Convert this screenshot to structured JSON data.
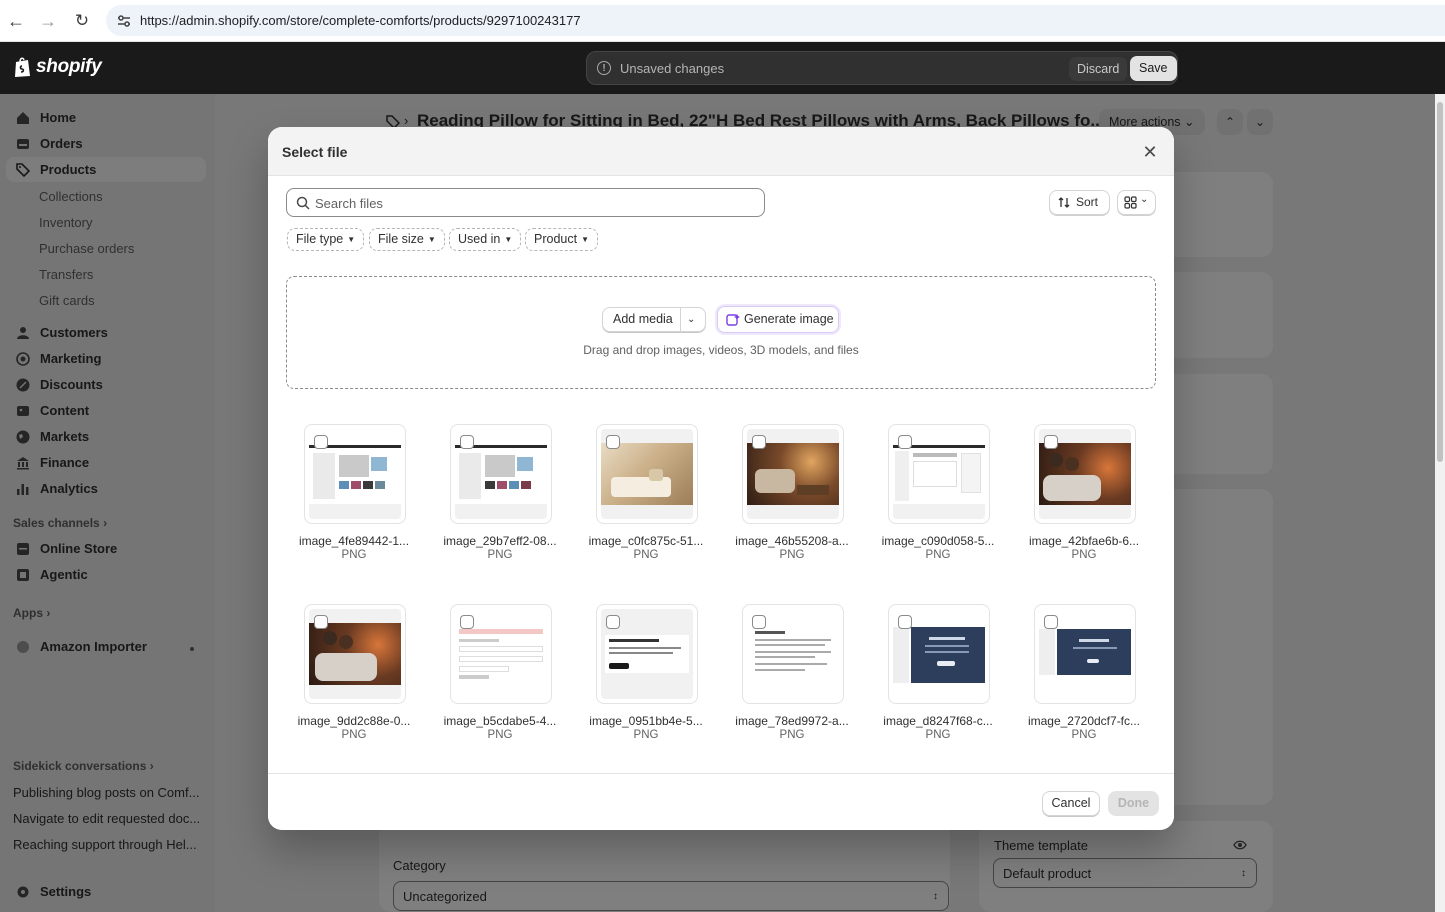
{
  "browser": {
    "url": "https://admin.shopify.com/store/complete-comforts/products/9297100243177"
  },
  "topbar": {
    "logo_text": "shopify",
    "unsaved_message": "Unsaved changes",
    "discard_label": "Discard",
    "save_label": "Save"
  },
  "sidebar": {
    "main_items": [
      {
        "label": "Home",
        "icon": "home-icon"
      },
      {
        "label": "Orders",
        "icon": "orders-icon"
      },
      {
        "label": "Products",
        "icon": "tag-icon",
        "active": true
      }
    ],
    "product_subitems": [
      "Collections",
      "Inventory",
      "Purchase orders",
      "Transfers",
      "Gift cards"
    ],
    "more_items": [
      {
        "label": "Customers",
        "icon": "person-icon"
      },
      {
        "label": "Marketing",
        "icon": "target-icon"
      },
      {
        "label": "Discounts",
        "icon": "discount-icon"
      },
      {
        "label": "Content",
        "icon": "content-icon"
      },
      {
        "label": "Markets",
        "icon": "globe-icon"
      },
      {
        "label": "Finance",
        "icon": "bank-icon"
      },
      {
        "label": "Analytics",
        "icon": "chart-icon"
      }
    ],
    "sales_channels_label": "Sales channels",
    "channels": [
      {
        "label": "Online Store",
        "icon": "store-icon"
      },
      {
        "label": "Agentic",
        "icon": "agentic-icon"
      }
    ],
    "apps_label": "Apps",
    "apps": [
      {
        "label": "Amazon Importer",
        "icon": "app-icon"
      }
    ],
    "sidekick_label": "Sidekick conversations",
    "conversations": [
      "Publishing blog posts on Comf...",
      "Navigate to edit requested doc...",
      "Reaching support through Hel..."
    ],
    "settings_label": "Settings"
  },
  "page": {
    "title": "Reading Pillow for Sitting in Bed, 22\"H Bed Rest Pillows with Arms, Back Pillows fo...",
    "more_actions_label": "More actions",
    "category_label": "Category",
    "category_value": "Uncategorized",
    "theme_template_label": "Theme template",
    "theme_template_value": "Default product"
  },
  "modal": {
    "title": "Select file",
    "search_placeholder": "Search files",
    "sort_label": "Sort",
    "filters": [
      "File type",
      "File size",
      "Used in",
      "Product"
    ],
    "add_media_label": "Add media",
    "generate_image_label": "Generate image",
    "drop_hint": "Drag and drop images, videos, 3D models, and files",
    "files": [
      {
        "name": "image_4fe89442-1...",
        "type": "PNG",
        "thumb": "screenshot-store"
      },
      {
        "name": "image_29b7eff2-08...",
        "type": "PNG",
        "thumb": "screenshot-store"
      },
      {
        "name": "image_c0fc875c-51...",
        "type": "PNG",
        "thumb": "photo-bed-tray"
      },
      {
        "name": "image_46b55208-a...",
        "type": "PNG",
        "thumb": "photo-candles"
      },
      {
        "name": "image_c090d058-5...",
        "type": "PNG",
        "thumb": "screenshot-admin"
      },
      {
        "name": "image_42bfae6b-6...",
        "type": "PNG",
        "thumb": "photo-couple"
      },
      {
        "name": "image_9dd2c88e-0...",
        "type": "PNG",
        "thumb": "photo-couple"
      },
      {
        "name": "image_b5cdabe5-4...",
        "type": "PNG",
        "thumb": "screenshot-form"
      },
      {
        "name": "image_0951bb4e-5...",
        "type": "PNG",
        "thumb": "screenshot-chat-offline"
      },
      {
        "name": "image_78ed9972-a...",
        "type": "PNG",
        "thumb": "screenshot-document"
      },
      {
        "name": "image_d8247f68-c...",
        "type": "PNG",
        "thumb": "screenshot-dark"
      },
      {
        "name": "image_2720dcf7-fc...",
        "type": "PNG",
        "thumb": "screenshot-dark"
      }
    ],
    "cancel_label": "Cancel",
    "done_label": "Done"
  }
}
